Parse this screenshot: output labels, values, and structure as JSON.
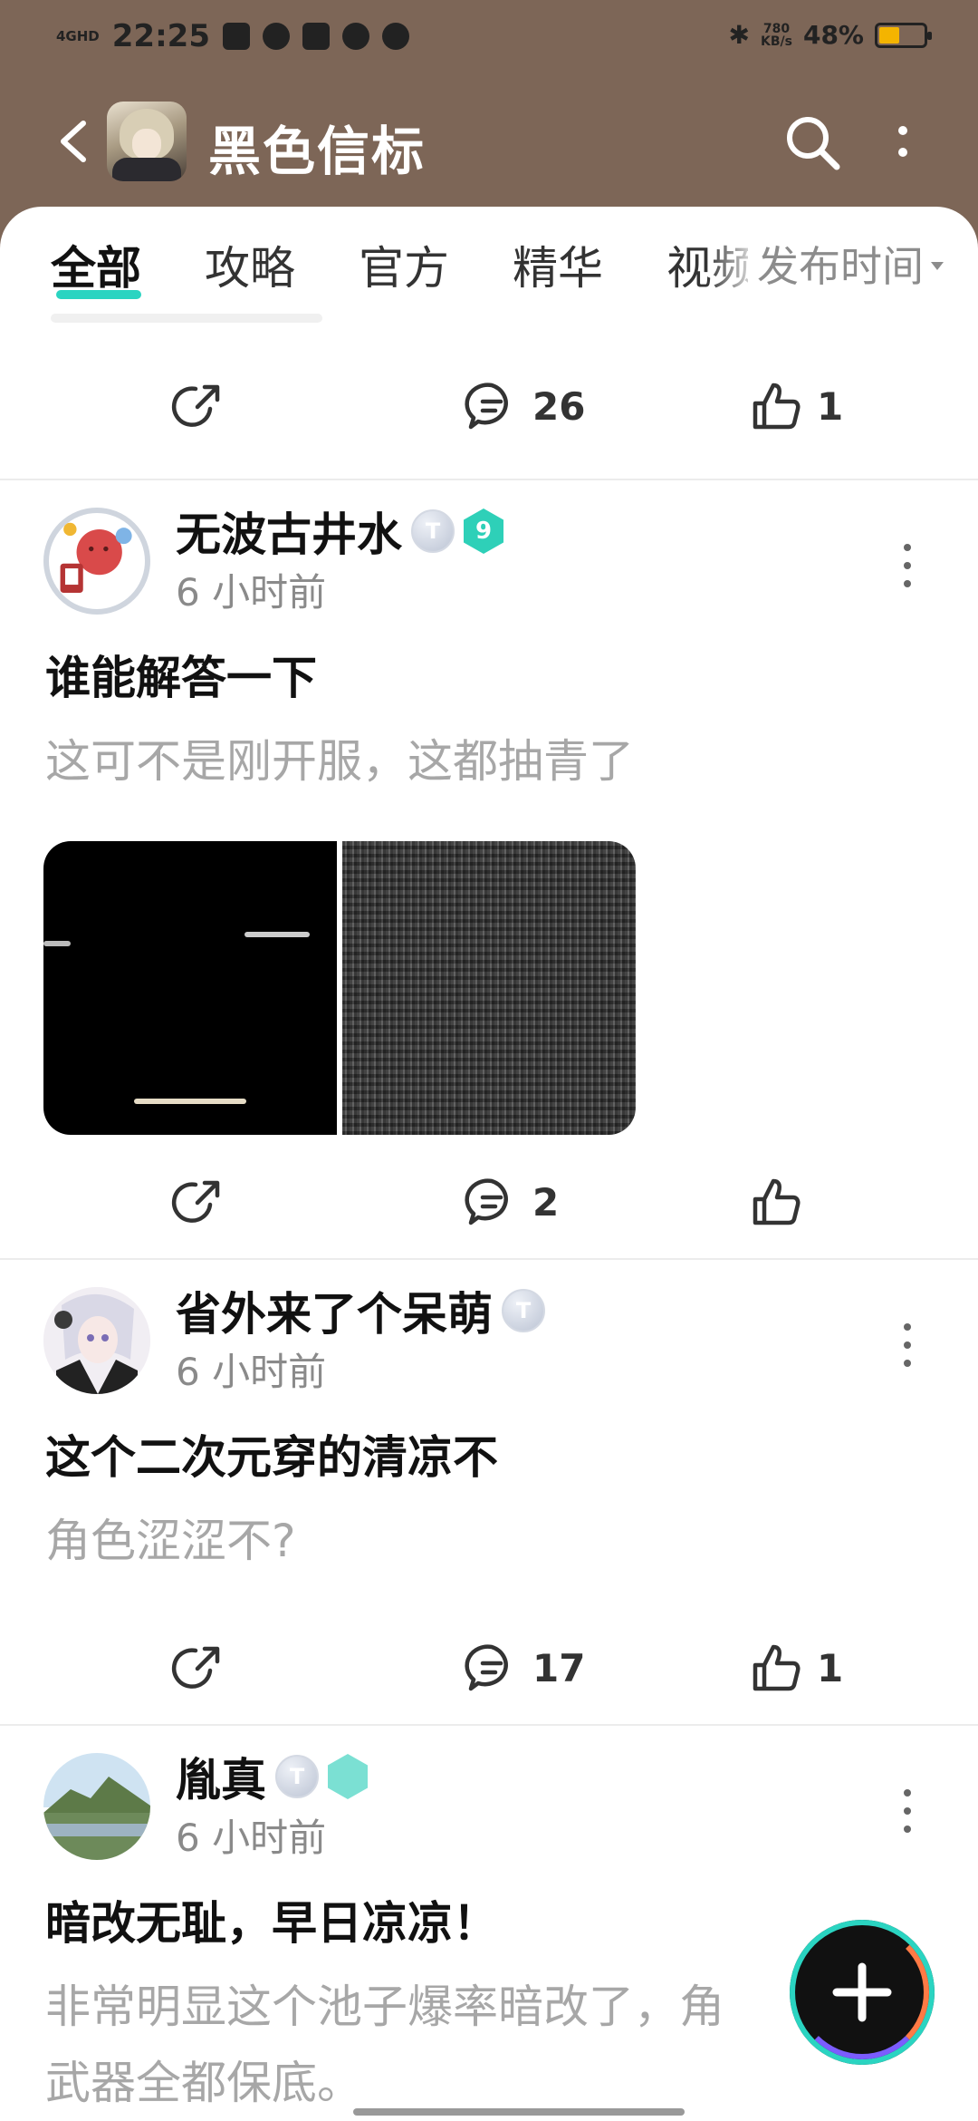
{
  "statusbar": {
    "time": "22:25",
    "network_type": "4GHD",
    "speed_value": "780",
    "speed_unit": "KB/s",
    "battery": "48%",
    "battery_level": 0.48,
    "app_icons": [
      "taobao-icon",
      "bird-icon",
      "mail-icon",
      "chat-icon",
      "shield-icon"
    ]
  },
  "header": {
    "title": "黑色信标",
    "back_icon": "chevron-left-icon",
    "search_icon": "search-icon",
    "more_icon": "more-vertical-icon"
  },
  "tabs": {
    "items": [
      "全部",
      "攻略",
      "官方",
      "精华",
      "视频"
    ],
    "active_index": 0,
    "sort_label": "发布时间",
    "accent": "#2ad4c1"
  },
  "top_actions": {
    "comments": "26",
    "likes": "1"
  },
  "posts": [
    {
      "username": "无波古井水",
      "badge_t": "T",
      "badge_level": "9",
      "time": "6 小时前",
      "title": "谁能解答一下",
      "excerpt": "这可不是刚开服，这都抽青了",
      "comments": "2",
      "likes": ""
    },
    {
      "username": "省外来了个呆萌",
      "badge_t": "T",
      "time": "6 小时前",
      "title": "这个二次元穿的清凉不",
      "excerpt": "角色涩涩不?",
      "comments": "17",
      "likes": "1"
    },
    {
      "username": "胤真",
      "badge_t": "T",
      "time": "6 小时前",
      "title": "暗改无耻，早日凉凉！",
      "excerpt_line1": "非常明显这个池子爆率暗改了，角",
      "excerpt_line2": "武器全都保底。"
    }
  ],
  "fab": {
    "icon": "plus-icon"
  }
}
